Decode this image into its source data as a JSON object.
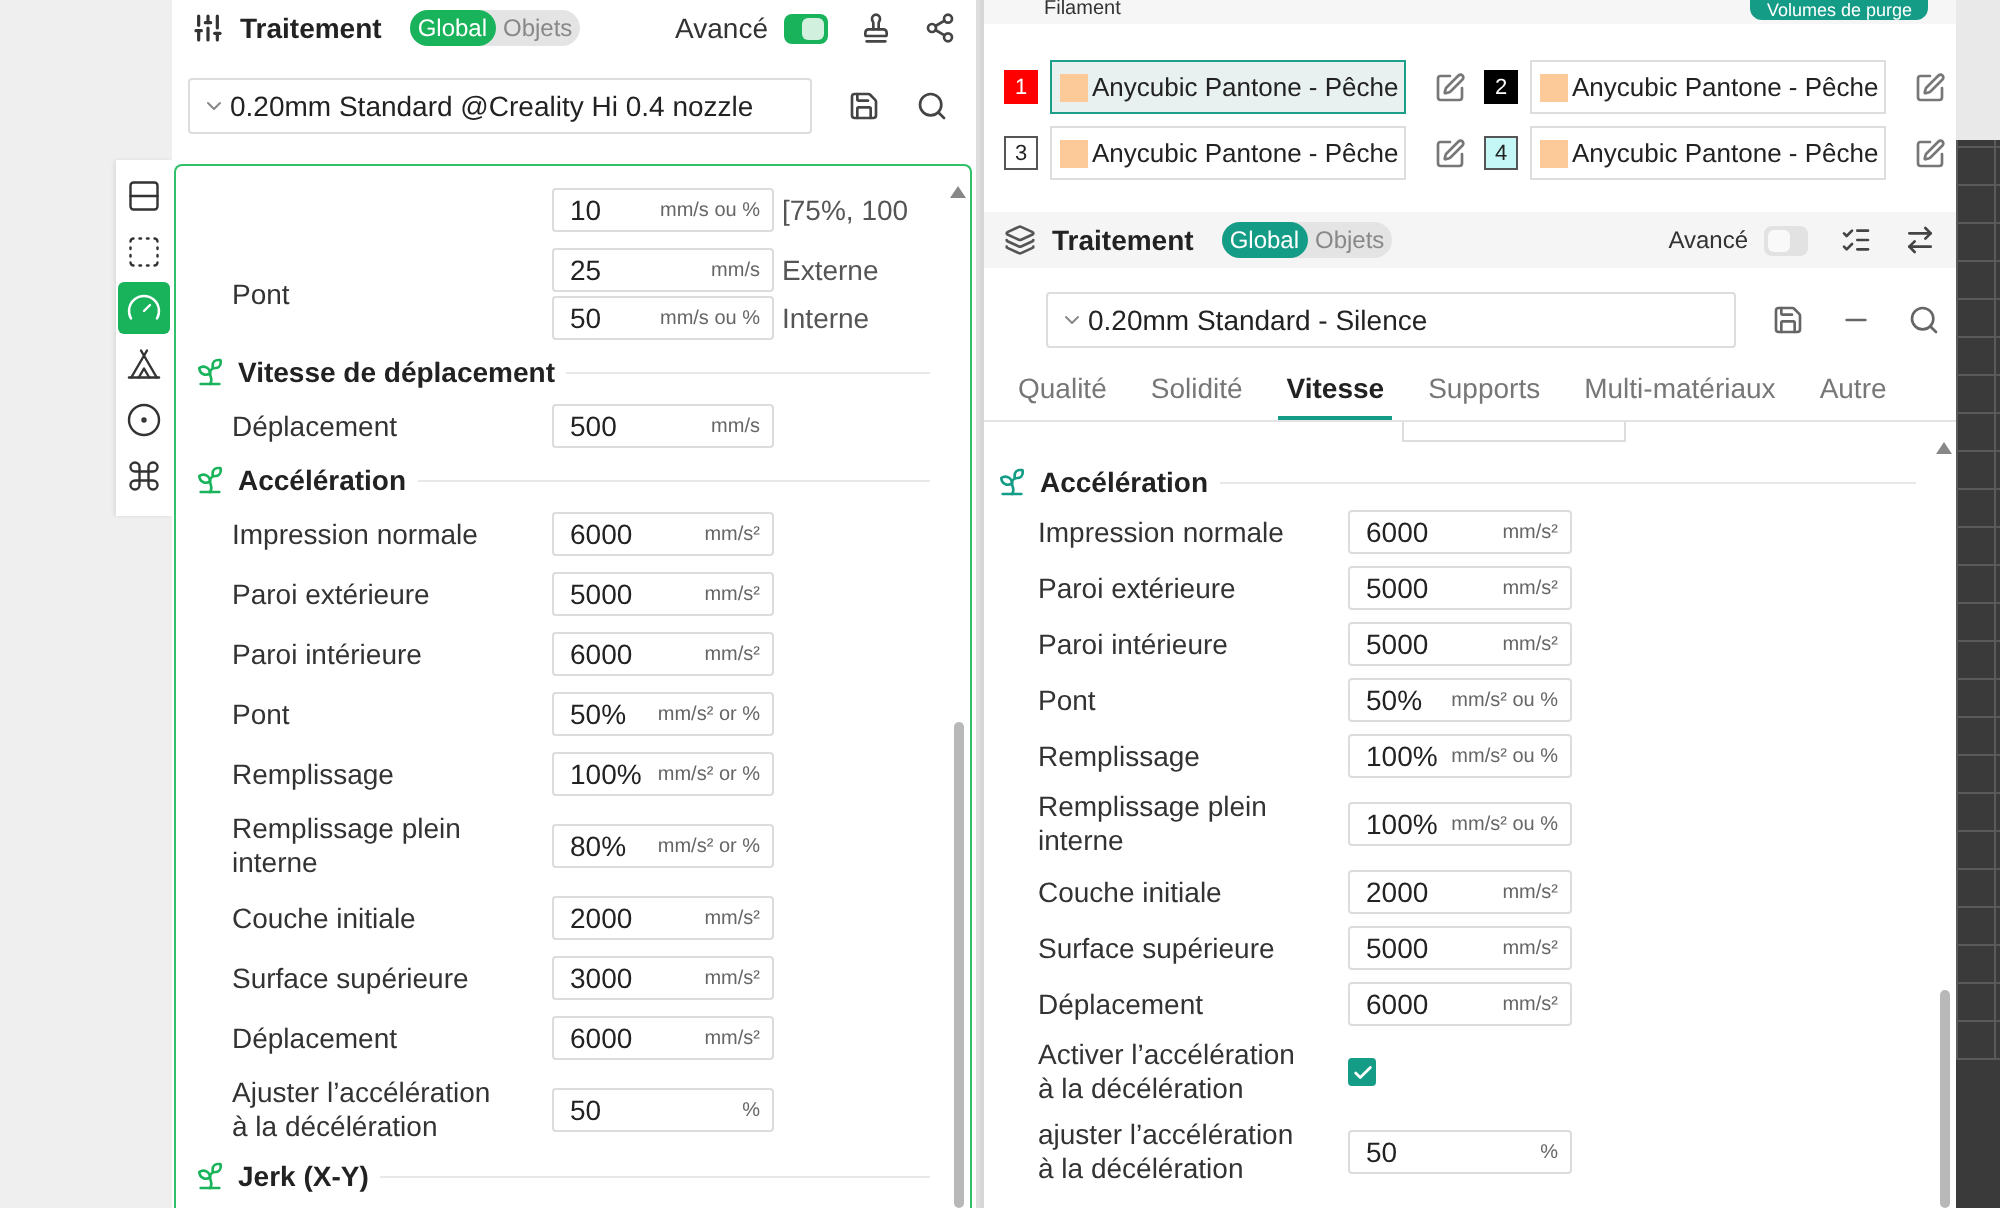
{
  "left_panel": {
    "header": {
      "title": "Traitement",
      "scope_tabs": [
        {
          "label": "Global",
          "selected": true
        },
        {
          "label": "Objets",
          "selected": false
        }
      ],
      "advanced": {
        "label": "Avancé",
        "on": true
      }
    },
    "sidebar": [
      {
        "selected": false
      },
      {
        "selected": false
      },
      {
        "selected": true
      },
      {
        "selected": false
      },
      {
        "selected": false
      },
      {
        "selected": false
      }
    ],
    "preset": "0.20mm Standard @Creality Hi 0.4 nozzle",
    "settings": [
      {
        "kind": "field",
        "fields": [
          {
            "value": "10",
            "unit": "mm/s ou %",
            "note": "[75%, 100"
          }
        ]
      },
      {
        "kind": "field",
        "label": "Pont",
        "fields": [
          {
            "value": "25",
            "unit": "mm/s",
            "note": "Externe"
          },
          {
            "value": "50",
            "unit": "mm/s ou %",
            "note": "Interne"
          }
        ]
      },
      {
        "kind": "section",
        "title": "Vitesse de déplacement"
      },
      {
        "kind": "field",
        "label": "Déplacement",
        "fields": [
          {
            "value": "500",
            "unit": "mm/s"
          }
        ]
      },
      {
        "kind": "section",
        "title": "Accélération"
      },
      {
        "kind": "field",
        "label": "Impression normale",
        "fields": [
          {
            "value": "6000",
            "unit": "mm/s²"
          }
        ]
      },
      {
        "kind": "field",
        "label": "Paroi extérieure",
        "fields": [
          {
            "value": "5000",
            "unit": "mm/s²"
          }
        ]
      },
      {
        "kind": "field",
        "label": "Paroi intérieure",
        "fields": [
          {
            "value": "6000",
            "unit": "mm/s²"
          }
        ]
      },
      {
        "kind": "field",
        "label": "Pont",
        "fields": [
          {
            "value": "50%",
            "unit": "mm/s² or %"
          }
        ]
      },
      {
        "kind": "field",
        "label": "Remplissage",
        "fields": [
          {
            "value": "100%",
            "unit": "mm/s² or %"
          }
        ]
      },
      {
        "kind": "field",
        "label": "Remplissage plein\ninterne",
        "fields": [
          {
            "value": "80%",
            "unit": "mm/s² or %"
          }
        ]
      },
      {
        "kind": "field",
        "label": "Couche initiale",
        "fields": [
          {
            "value": "2000",
            "unit": "mm/s²"
          }
        ]
      },
      {
        "kind": "field",
        "label": "Surface supérieure",
        "fields": [
          {
            "value": "3000",
            "unit": "mm/s²"
          }
        ]
      },
      {
        "kind": "field",
        "label": "Déplacement",
        "fields": [
          {
            "value": "6000",
            "unit": "mm/s²"
          }
        ]
      },
      {
        "kind": "field",
        "label": "Ajuster l’accélération\nà la décélération",
        "fields": [
          {
            "value": "50",
            "unit": "%"
          }
        ]
      },
      {
        "kind": "section",
        "title": "Jerk (X-Y)"
      }
    ]
  },
  "right_panel": {
    "filament": {
      "title": "Filament",
      "purge_button": "Volumes de purge",
      "items": [
        {
          "number": "1",
          "color": "#ff0000",
          "name": "Anycubic Pantone - Pêche",
          "selected": true
        },
        {
          "number": "2",
          "color": "#000000",
          "name": "Anycubic Pantone - Pêche",
          "selected": false
        },
        {
          "number": "3",
          "color": "#ffffff",
          "name": "Anycubic Pantone - Pêche",
          "selected": false
        },
        {
          "number": "4",
          "color": "#c6f7f7",
          "name": "Anycubic Pantone - Pêche",
          "selected": false
        }
      ]
    },
    "header": {
      "title": "Traitement",
      "scope_tabs": [
        {
          "label": "Global",
          "selected": true
        },
        {
          "label": "Objets",
          "selected": false
        }
      ],
      "advanced": {
        "label": "Avancé",
        "on": false
      }
    },
    "preset": "0.20mm Standard - Silence",
    "tabs": [
      {
        "label": "Qualité",
        "selected": false
      },
      {
        "label": "Solidité",
        "selected": false
      },
      {
        "label": "Vitesse",
        "selected": true
      },
      {
        "label": "Supports",
        "selected": false
      },
      {
        "label": "Multi-matériaux",
        "selected": false
      },
      {
        "label": "Autre",
        "selected": false
      }
    ],
    "settings": [
      {
        "kind": "section",
        "title": "Accélération"
      },
      {
        "kind": "field",
        "label": "Impression normale",
        "fields": [
          {
            "value": "6000",
            "unit": "mm/s²"
          }
        ]
      },
      {
        "kind": "field",
        "label": "Paroi extérieure",
        "fields": [
          {
            "value": "5000",
            "unit": "mm/s²"
          }
        ]
      },
      {
        "kind": "field",
        "label": "Paroi intérieure",
        "fields": [
          {
            "value": "5000",
            "unit": "mm/s²"
          }
        ]
      },
      {
        "kind": "field",
        "label": "Pont",
        "fields": [
          {
            "value": "50%",
            "unit": "mm/s² ou %"
          }
        ]
      },
      {
        "kind": "field",
        "label": "Remplissage",
        "fields": [
          {
            "value": "100%",
            "unit": "mm/s² ou %"
          }
        ]
      },
      {
        "kind": "field",
        "label": "Remplissage plein\ninterne",
        "fields": [
          {
            "value": "100%",
            "unit": "mm/s² ou %"
          }
        ]
      },
      {
        "kind": "field",
        "label": "Couche initiale",
        "fields": [
          {
            "value": "2000",
            "unit": "mm/s²"
          }
        ]
      },
      {
        "kind": "field",
        "label": "Surface supérieure",
        "fields": [
          {
            "value": "5000",
            "unit": "mm/s²"
          }
        ]
      },
      {
        "kind": "field",
        "label": "Déplacement",
        "fields": [
          {
            "value": "6000",
            "unit": "mm/s²"
          }
        ]
      },
      {
        "kind": "checkbox",
        "label": "Activer l’accélération\nà la décélération",
        "checked": true
      },
      {
        "kind": "field",
        "label": "ajuster l’accélération\nà la décélération",
        "fields": [
          {
            "value": "50",
            "unit": "%"
          }
        ]
      }
    ]
  }
}
